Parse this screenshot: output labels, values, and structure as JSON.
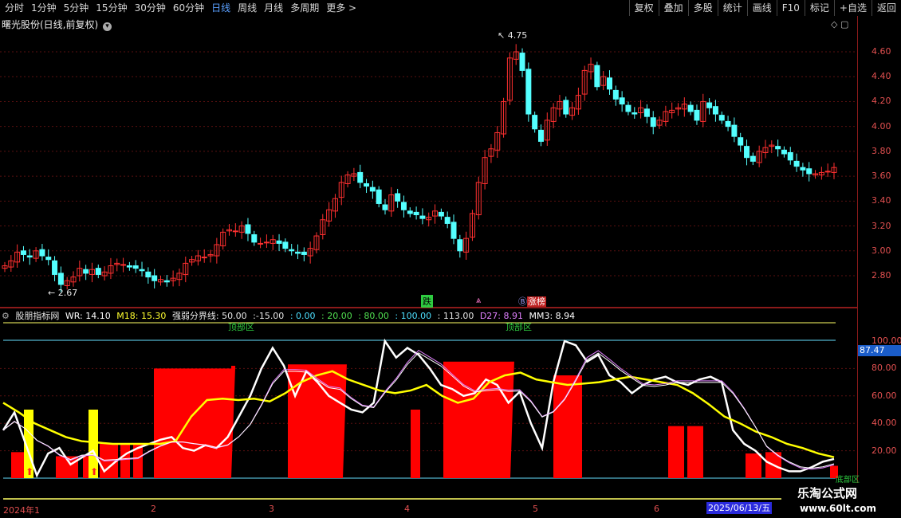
{
  "toolbar": {
    "periods": [
      "分时",
      "1分钟",
      "5分钟",
      "15分钟",
      "30分钟",
      "60分钟",
      "日线",
      "周线",
      "月线",
      "多周期",
      "更多 >"
    ],
    "active_period": "日线",
    "right_buttons": [
      "复权",
      "叠加",
      "多股",
      "统计",
      "画线",
      "F10",
      "标记",
      "+自选",
      "返回"
    ]
  },
  "stock": {
    "title": "曙光股份(日线,前复权)"
  },
  "price_axis": [
    "4.60",
    "4.40",
    "4.20",
    "4.00",
    "3.80",
    "3.60",
    "3.40",
    "3.20",
    "3.00",
    "2.80"
  ],
  "annotations": {
    "high": "4.75",
    "low": "2.67",
    "down_tag": "跌",
    "board_tag": "涨榜",
    "board_prefix": "Ⓑ"
  },
  "indicator": {
    "name": "股朋指标网",
    "wr": "WR: 14.10",
    "m18": "M18: 15.30",
    "divider": "强弱分界线: 50.00",
    "levels": [
      ":-15.00",
      ": 0.00",
      ": 20.00",
      ": 80.00",
      ": 100.00",
      ": 113.00"
    ],
    "d27": "D27: 8.91",
    "mm3": "MM3: 8.94",
    "top_zone": "顶部区",
    "bottom_zone": "底部区",
    "current_value": "87.47"
  },
  "ind_axis": [
    "100.00",
    "80.00",
    "60.00",
    "40.00",
    "20.00"
  ],
  "dates": {
    "start": "2024年1",
    "months": [
      "2",
      "3",
      "4",
      "5",
      "6"
    ],
    "current": "2025/06/13/五"
  },
  "watermark": {
    "line1": "乐淘公式网",
    "line2": "www.60lt.com"
  },
  "colors": {
    "up": "#ff3030",
    "down": "#54ffff",
    "wr": "#ffffff",
    "m18": "#ffff00",
    "bar": "#ff0000"
  },
  "chart_data": {
    "type": "line",
    "close": [
      2.88,
      2.92,
      2.99,
      2.97,
      2.95,
      3.0,
      2.96,
      2.93,
      2.81,
      2.73,
      2.76,
      2.79,
      2.86,
      2.82,
      2.85,
      2.81,
      2.83,
      2.88,
      2.9,
      2.89,
      2.87,
      2.86,
      2.84,
      2.79,
      2.76,
      2.77,
      2.75,
      2.78,
      2.82,
      2.9,
      2.93,
      2.96,
      2.95,
      2.97,
      3.05,
      3.15,
      3.17,
      3.16,
      3.2,
      3.14,
      3.07,
      3.06,
      3.07,
      3.09,
      3.06,
      3.02,
      3.0,
      2.98,
      2.97,
      3.02,
      3.12,
      3.25,
      3.33,
      3.42,
      3.55,
      3.61,
      3.62,
      3.55,
      3.52,
      3.48,
      3.38,
      3.33,
      3.45,
      3.4,
      3.33,
      3.3,
      3.29,
      3.26,
      3.27,
      3.32,
      3.28,
      3.22,
      3.1,
      3.0,
      3.1,
      3.3,
      3.55,
      3.75,
      3.82,
      3.95,
      4.2,
      4.55,
      4.6,
      4.45,
      4.1,
      3.98,
      3.88,
      4.05,
      4.15,
      4.2,
      4.1,
      4.15,
      4.25,
      4.45,
      4.5,
      4.32,
      4.4,
      4.3,
      4.22,
      4.18,
      4.12,
      4.1,
      4.15,
      4.08,
      4.0,
      4.05,
      4.12,
      4.13,
      4.15,
      4.18,
      4.12,
      4.05,
      4.2,
      4.15,
      4.1,
      4.05,
      4.0,
      3.92,
      3.85,
      3.75,
      3.72,
      3.8,
      3.83,
      3.85,
      3.82,
      3.78,
      3.73,
      3.68,
      3.65,
      3.62,
      3.62,
      3.63,
      3.64,
      3.67
    ]
  }
}
